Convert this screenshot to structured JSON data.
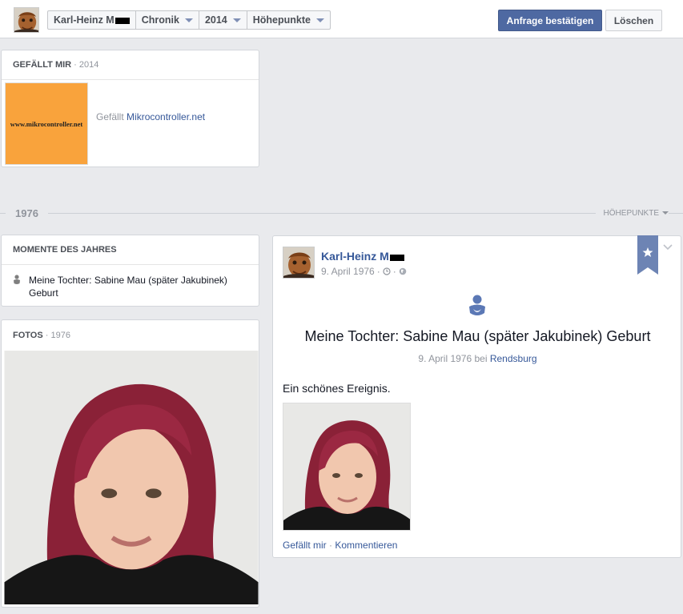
{
  "topbar": {
    "crumbs": {
      "name": "Karl-Heinz M",
      "timeline": "Chronik",
      "year": "2014",
      "filter": "Höhepunkte"
    },
    "confirm_label": "Anfrage bestätigen",
    "delete_label": "Löschen"
  },
  "likes": {
    "title": "GEFÄLLT MIR",
    "year": "2014",
    "thumb_text": "www.mikrocontroller.net",
    "text_prefix": "Gefällt",
    "page_link": "Mikrocontroller.net"
  },
  "year_divider": {
    "year": "1976",
    "highlights": "HÖHEPUNKTE"
  },
  "moments": {
    "title": "MOMENTE DES JAHRES",
    "item": "Meine Tochter: Sabine Mau (später Jakubinek) Geburt"
  },
  "photos": {
    "title": "FOTOS",
    "year": "1976"
  },
  "post": {
    "author": "Karl-Heinz M",
    "date": "9. April 1976",
    "event_title": "Meine Tochter: Sabine Mau (später Jakubinek) Geburt",
    "event_date": "9. April 1976",
    "event_at": "bei",
    "event_place": "Rendsburg",
    "text": "Ein schönes Ereignis.",
    "like_label": "Gefällt mir",
    "comment_label": "Kommentieren"
  },
  "colors": {
    "brand_blue": "#4e69a2",
    "link_blue": "#365899",
    "page_bg": "#e9eaed",
    "orange_thumb": "#f9a33c"
  }
}
